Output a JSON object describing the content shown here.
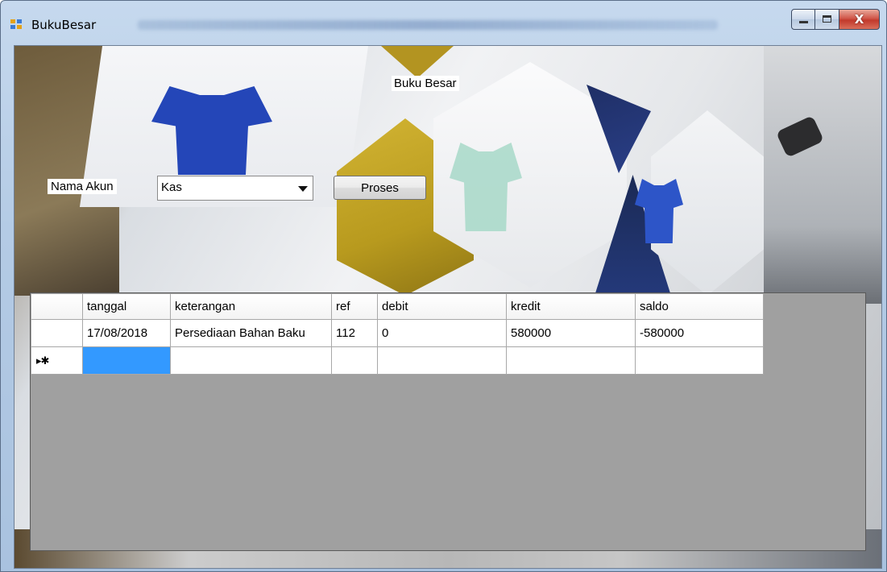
{
  "window": {
    "title": "BukuBesar",
    "close_glyph": "X"
  },
  "form": {
    "heading": "Buku Besar",
    "account_label": "Nama Akun",
    "account_value": "Kas",
    "process_button": "Proses"
  },
  "grid": {
    "columns": [
      "tanggal",
      "keterangan",
      "ref",
      "debit",
      "kredit",
      "saldo"
    ],
    "rows": [
      [
        "17/08/2018",
        "Persediaan Bahan Baku",
        "112",
        "0",
        "580000",
        "-580000"
      ]
    ],
    "new_row_marker": "▸✱",
    "selection_color": "#3399ff"
  }
}
